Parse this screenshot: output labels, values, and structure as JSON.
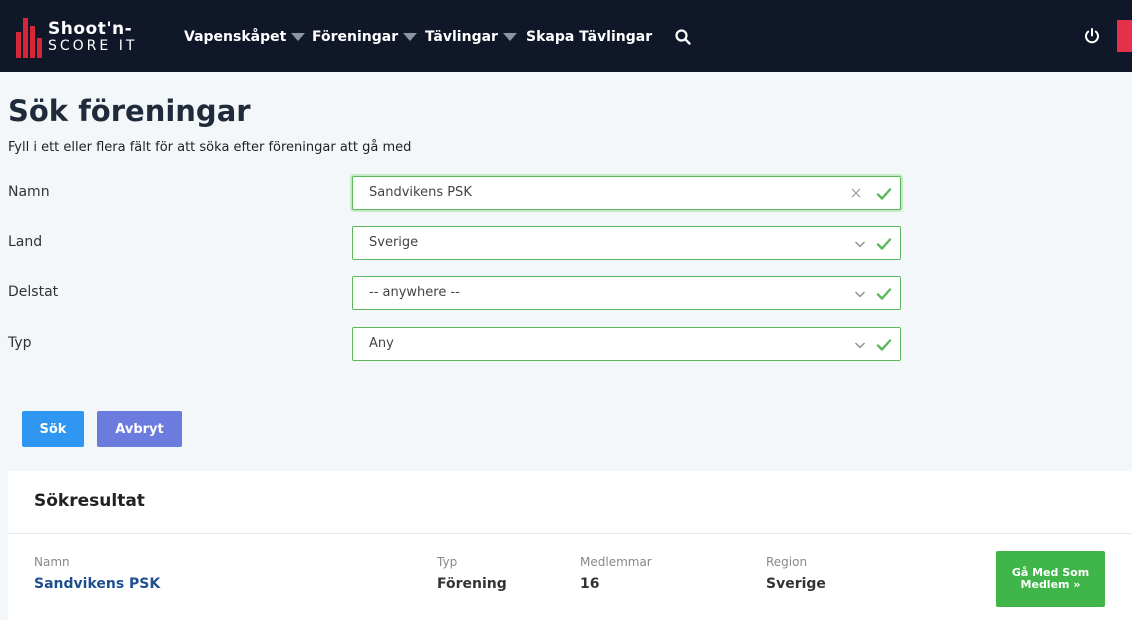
{
  "logo": {
    "line1": "Shoot'n-",
    "line2": "SCORE IT"
  },
  "nav": {
    "items": [
      {
        "label": "Vapenskåpet",
        "has_dropdown": true
      },
      {
        "label": "Föreningar",
        "has_dropdown": true
      },
      {
        "label": "Tävlingar",
        "has_dropdown": true
      },
      {
        "label": "Skapa Tävlingar",
        "has_dropdown": false
      }
    ],
    "icons": {
      "search": "search-icon",
      "power": "power-icon"
    }
  },
  "page": {
    "title": "Sök föreningar",
    "subtitle": "Fyll i ett eller flera fält för att söka efter föreningar att gå med"
  },
  "form": {
    "fields": [
      {
        "label": "Namn",
        "value": "Sandvikens PSK",
        "control": "text",
        "clearable": true,
        "valid": true
      },
      {
        "label": "Land",
        "value": "Sverige",
        "control": "select",
        "valid": true
      },
      {
        "label": "Delstat",
        "value": "-- anywhere --",
        "control": "select",
        "valid": true
      },
      {
        "label": "Typ",
        "value": "Any",
        "control": "select",
        "valid": true
      }
    ],
    "search_label": "Sök",
    "cancel_label": "Avbryt"
  },
  "results": {
    "title": "Sökresultat",
    "columns": [
      "Namn",
      "Typ",
      "Medlemmar",
      "Region"
    ],
    "rows": [
      {
        "namn": "Sandvikens PSK",
        "typ": "Förening",
        "medlemmar": "16",
        "region": "Sverige",
        "action_label": "Gå Med Som Medlem »"
      }
    ]
  },
  "colors": {
    "navbar": "#101728",
    "brand_red": "#d6263a",
    "valid_green": "#5cb85c",
    "search_button": "#2f97f1",
    "cancel_button": "#6c7bde",
    "join_button": "#3fb54a",
    "link": "#1f4f8f"
  }
}
